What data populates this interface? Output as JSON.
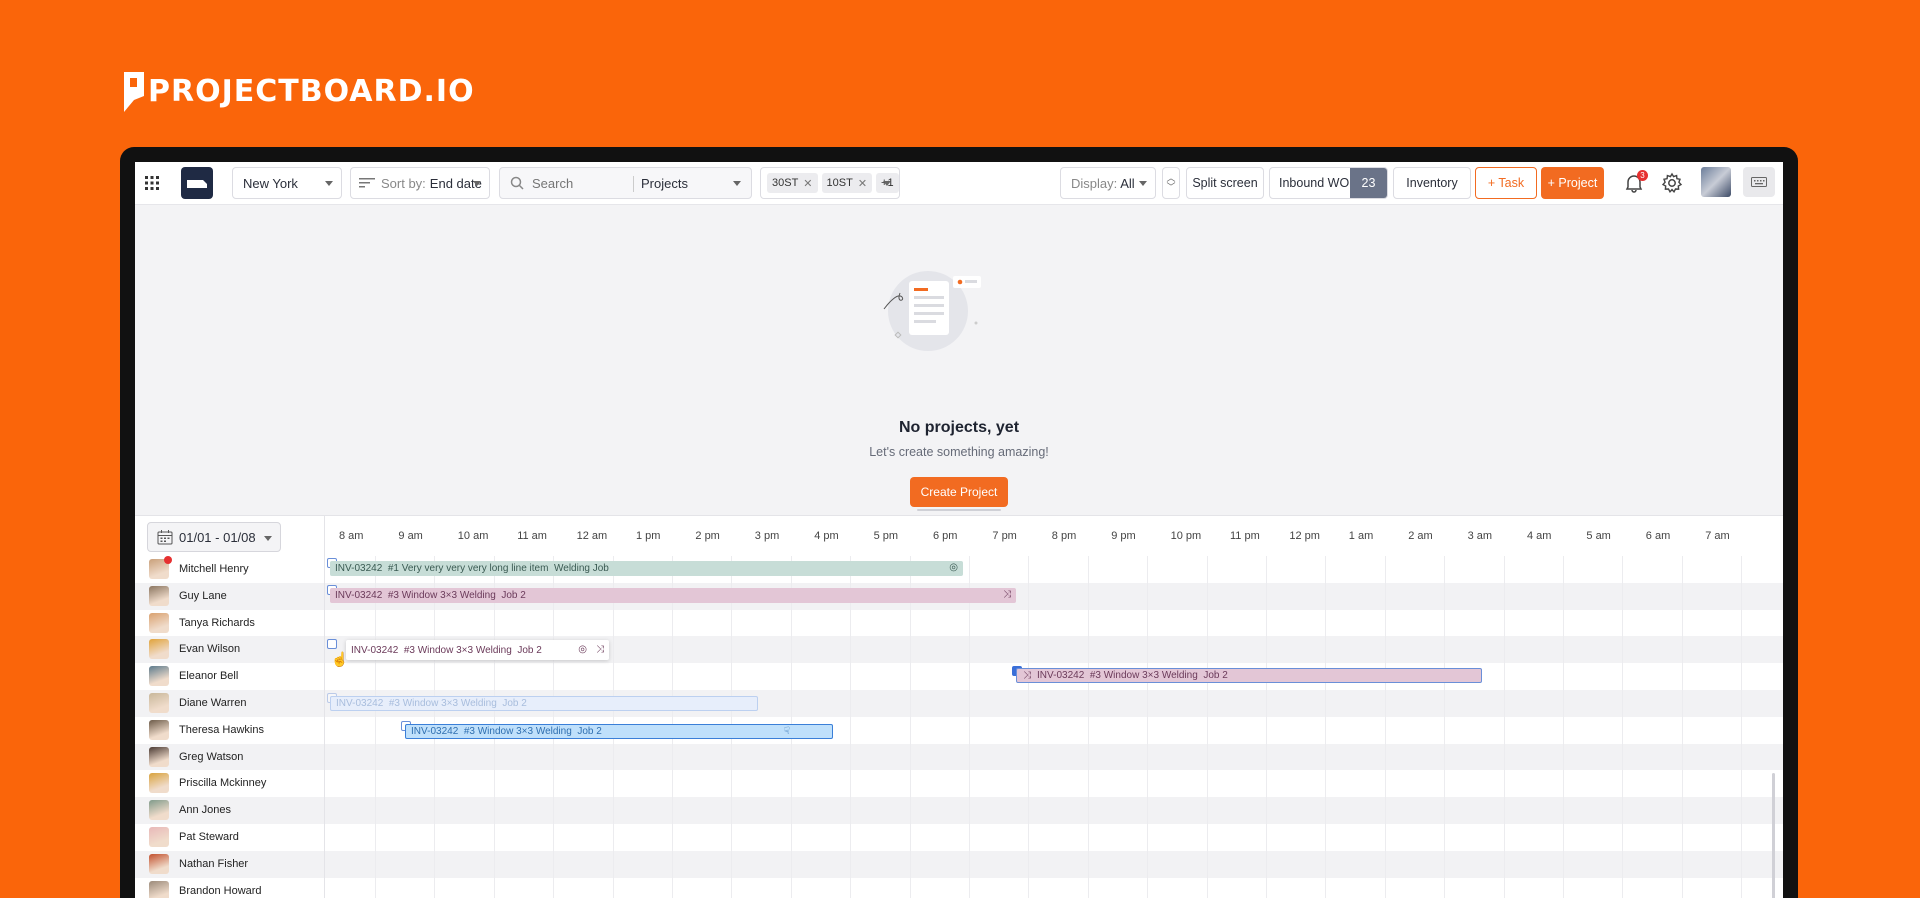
{
  "brand": {
    "name": "PROJECTBOARD.IO"
  },
  "colors": {
    "brand": "#fa650a",
    "accent": "#f26b21",
    "dark": "#1f2a44"
  },
  "toolbar": {
    "location": "New York",
    "sort_prefix": "Sort by:",
    "sort_value": "End date",
    "search_placeholder": "Search",
    "search_scope": "Projects",
    "chips": [
      "30ST",
      "10ST"
    ],
    "more_chips": "+1",
    "display_prefix": "Display:",
    "display_value": "All",
    "split_screen": "Split screen",
    "inbound_label": "Inbound WO",
    "inbound_count": "23",
    "inventory": "Inventory",
    "add_task": "+ Task",
    "add_project": "+ Project",
    "notification_count": "3"
  },
  "empty_state": {
    "title": "No projects, yet",
    "subtitle": "Let's create something amazing!",
    "button": "Create Project"
  },
  "schedule": {
    "date_range": "01/01 - 01/08",
    "hours": [
      "8 am",
      "9 am",
      "10 am",
      "11 am",
      "12 am",
      "1 pm",
      "2 pm",
      "3 pm",
      "4 pm",
      "5 pm",
      "6 pm",
      "7 pm",
      "8 pm",
      "9 pm",
      "10 pm",
      "11 pm",
      "12 pm",
      "1 am",
      "2 am",
      "3 am",
      "4 am",
      "5 am",
      "6 am",
      "7 am"
    ],
    "people": [
      {
        "name": "Mitchell Henry",
        "color": "#c9a07a",
        "notify": true
      },
      {
        "name": "Guy Lane",
        "color": "#8a7560"
      },
      {
        "name": "Tanya Richards",
        "color": "#d9a16f"
      },
      {
        "name": "Evan Wilson",
        "color": "#e0a33a"
      },
      {
        "name": "Eleanor Bell",
        "color": "#5b7a8c"
      },
      {
        "name": "Diane Warren",
        "color": "#c8b79a"
      },
      {
        "name": "Theresa Hawkins",
        "color": "#6b5a48"
      },
      {
        "name": "Greg Watson",
        "color": "#4a3a33"
      },
      {
        "name": "Priscilla Mckinney",
        "color": "#d8a23c"
      },
      {
        "name": "Ann Jones",
        "color": "#7f9a8a"
      },
      {
        "name": "Pat Steward",
        "color": "#e8b8b8"
      },
      {
        "name": "Nathan Fisher",
        "color": "#c2502e"
      },
      {
        "name": "Brandon Howard",
        "color": "#9b8a7a"
      }
    ],
    "bars": [
      {
        "inv": "INV-03242",
        "item": "#1 Very very very very long line item",
        "job": "Welding Job"
      },
      {
        "inv": "INV-03242",
        "item": "#3 Window 3×3 Welding",
        "job": "Job 2"
      },
      {
        "inv": "INV-03242",
        "item": "#3 Window 3×3 Welding",
        "job": "Job 2"
      },
      {
        "inv": "INV-03242",
        "item": "#3 Window 3×3 Welding",
        "job": "Job 2"
      },
      {
        "inv": "INV-03242",
        "item": "#3 Window 3×3 Welding",
        "job": "Job 2"
      },
      {
        "inv": "INV-03242",
        "item": "#3 Window 3×3 Welding",
        "job": "Job 2"
      }
    ]
  }
}
